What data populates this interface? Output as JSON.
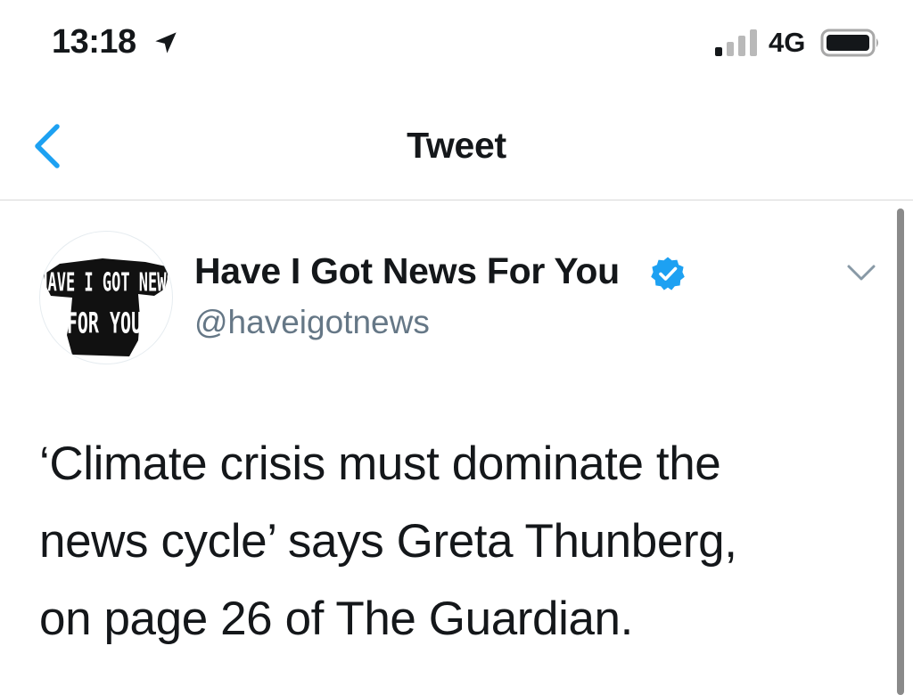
{
  "status_bar": {
    "time": "13:18",
    "network": "4G",
    "icons": {
      "location": "location-arrow-icon",
      "signal": "signal-strength-icon",
      "battery": "battery-icon"
    }
  },
  "nav": {
    "title": "Tweet",
    "back_icon": "chevron-left-icon"
  },
  "tweet": {
    "display_name": "Have I Got News For You",
    "handle": "@haveigotnews",
    "verified": true,
    "avatar_text": [
      "HAVE I GOT NEWS",
      "FOR YOU"
    ],
    "text": "‘Climate crisis must dominate the\nnews cycle’ says Greta Thunberg,\non page 26 of The Guardian.",
    "menu_icon": "chevron-down-icon"
  },
  "colors": {
    "accent": "#1da1f2",
    "text": "#14171a",
    "secondary_text": "#657786",
    "divider": "#d8d8d8"
  }
}
